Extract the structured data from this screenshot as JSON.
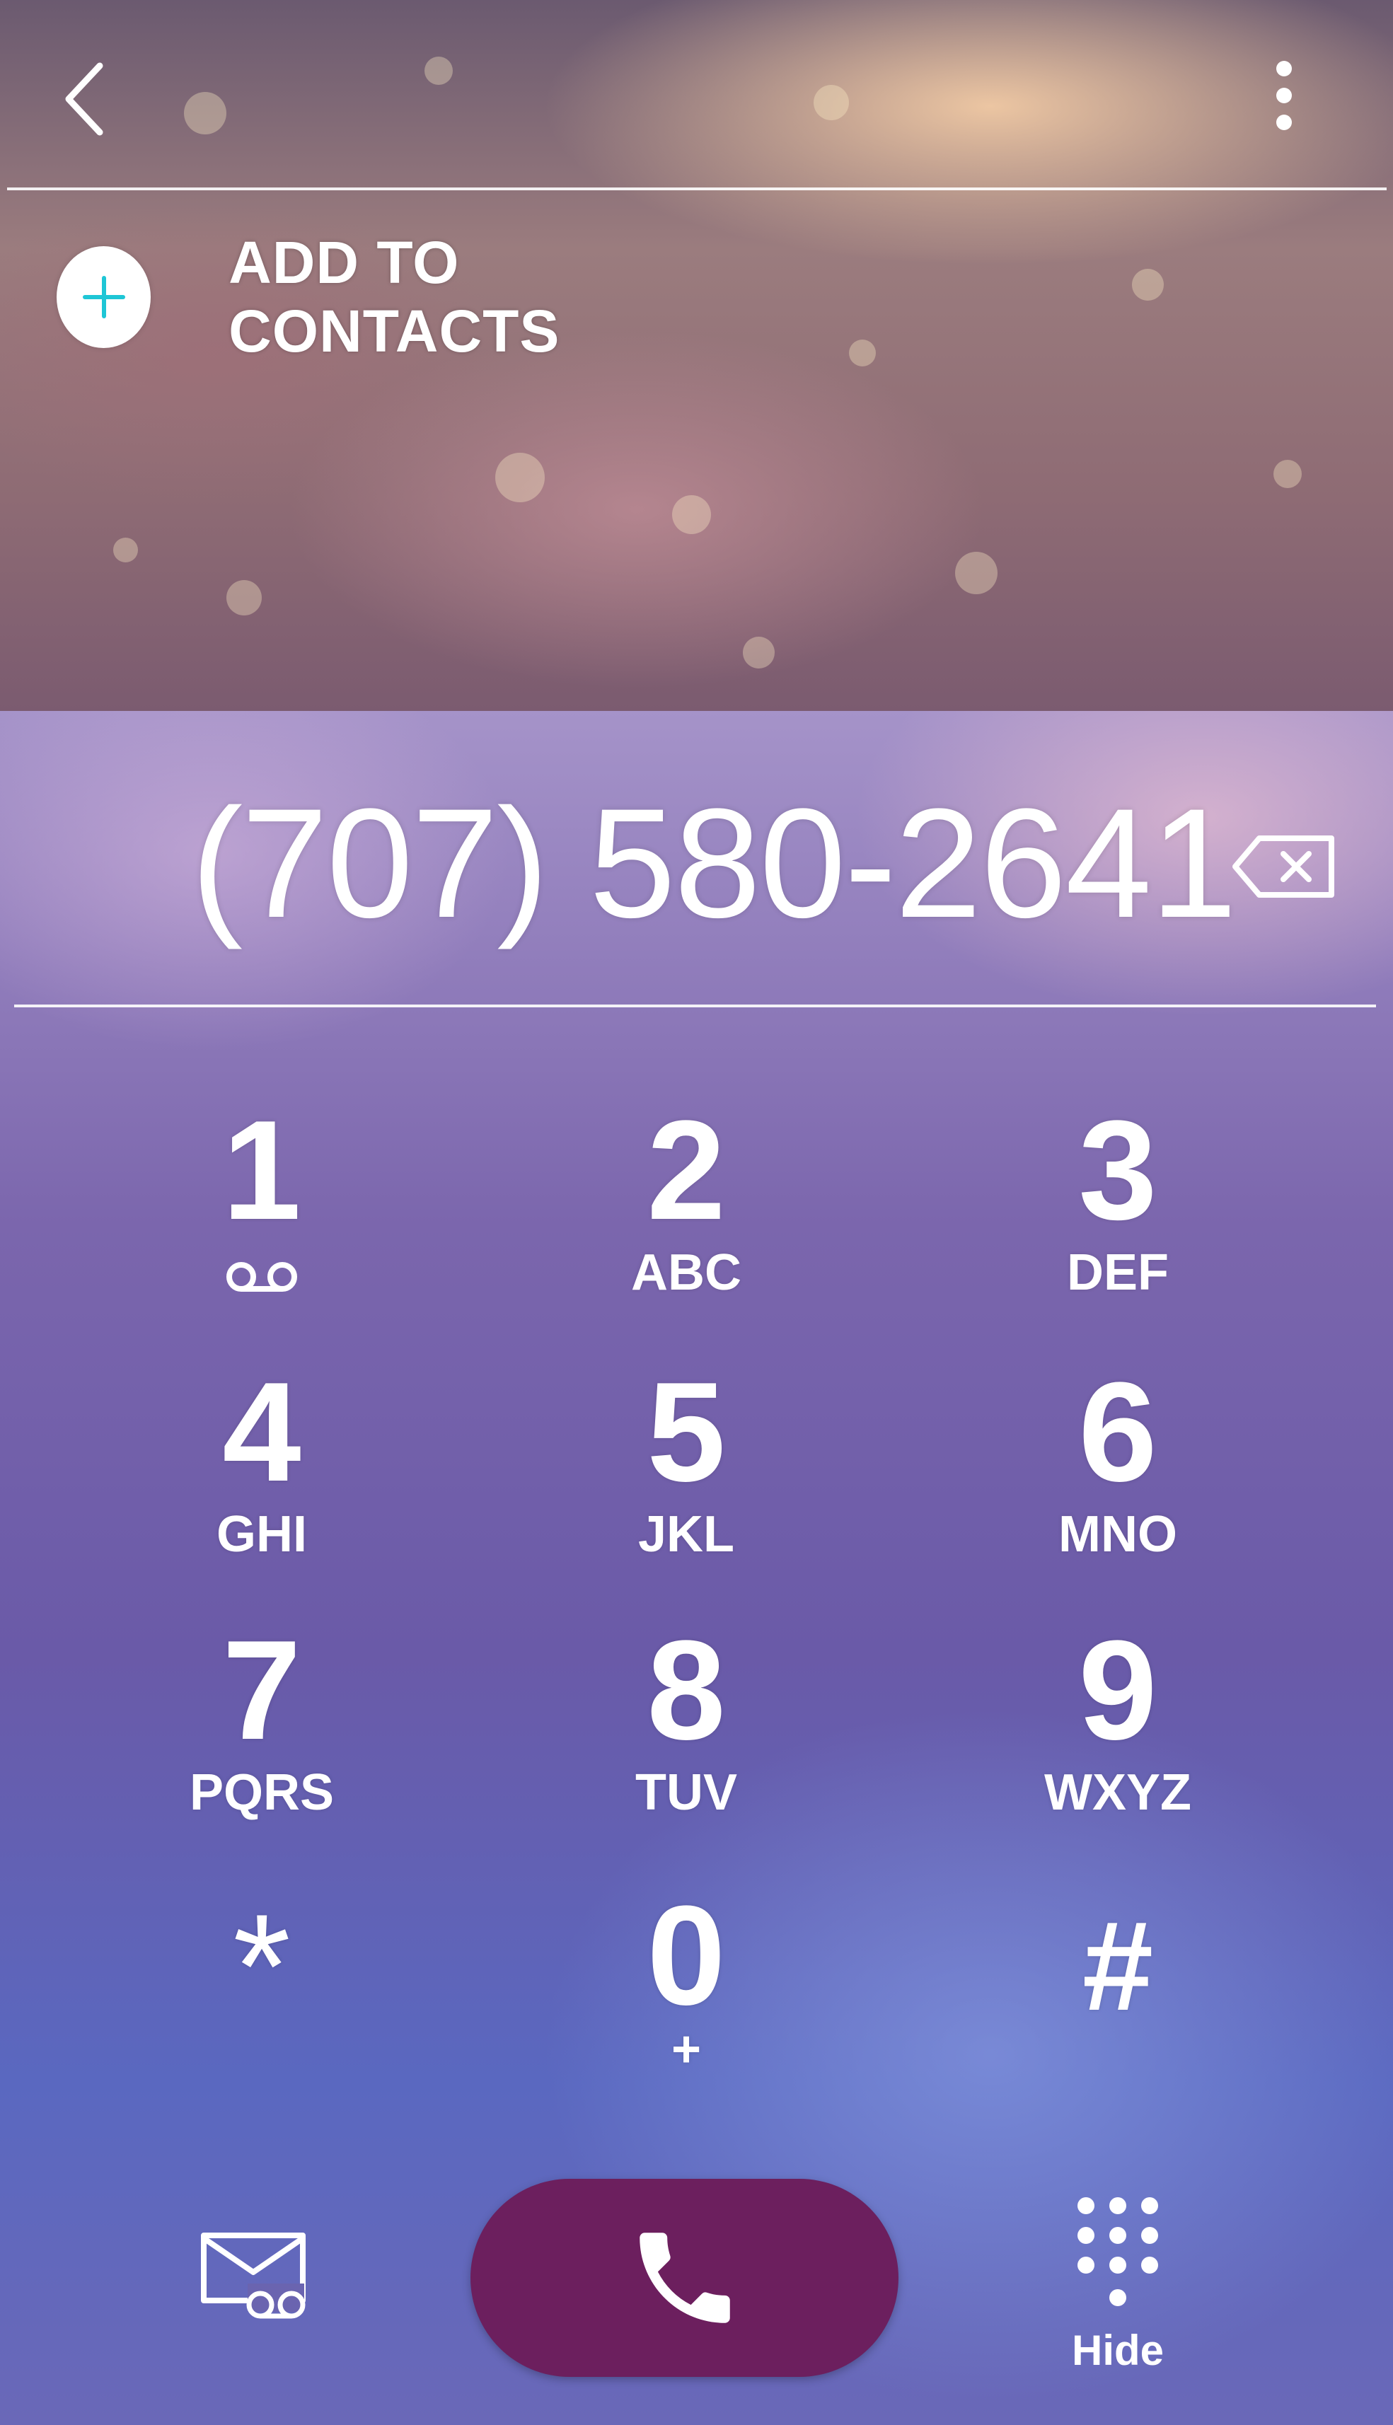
{
  "header": {
    "back_icon": "back-arrow-icon",
    "menu_icon": "more-vertical-icon"
  },
  "add_contacts": {
    "label": "ADD TO CONTACTS",
    "icon": "plus-icon",
    "accent_color": "#1ec6d6"
  },
  "dialer": {
    "number": "(707) 580-2641",
    "delete_icon": "backspace-icon"
  },
  "keypad": {
    "keys": [
      {
        "digit": "1",
        "letters": "",
        "sub_icon": "voicemail-icon"
      },
      {
        "digit": "2",
        "letters": "ABC"
      },
      {
        "digit": "3",
        "letters": "DEF"
      },
      {
        "digit": "4",
        "letters": "GHI"
      },
      {
        "digit": "5",
        "letters": "JKL"
      },
      {
        "digit": "6",
        "letters": "MNO"
      },
      {
        "digit": "7",
        "letters": "PQRS"
      },
      {
        "digit": "8",
        "letters": "TUV"
      },
      {
        "digit": "9",
        "letters": "WXYZ"
      },
      {
        "digit": "*",
        "letters": ""
      },
      {
        "digit": "0",
        "letters": "+"
      },
      {
        "digit": "#",
        "letters": ""
      }
    ]
  },
  "bottom_bar": {
    "message_icon": "video-voicemail-icon",
    "call_icon": "phone-icon",
    "call_button_color": "#6c1f5e",
    "hide_icon": "dialpad-icon",
    "hide_label": "Hide"
  }
}
